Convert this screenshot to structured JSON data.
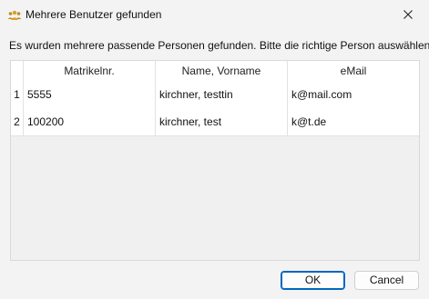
{
  "window": {
    "title": "Mehrere Benutzer gefunden",
    "icon": "users-group-icon",
    "close_icon": "close-icon"
  },
  "instruction": "Es wurden mehrere passende Personen gefunden. Bitte die richtige Person auswählen.",
  "table": {
    "columns": [
      "",
      "Matrikelnr.",
      "Name, Vorname",
      "eMail"
    ],
    "rows": [
      {
        "num": "1",
        "matrikel": "5555",
        "name": "kirchner, testtin",
        "email": "k@mail.com"
      },
      {
        "num": "2",
        "matrikel": "100200",
        "name": "kirchner, test",
        "email": "k@t.de"
      }
    ]
  },
  "buttons": {
    "ok": "OK",
    "cancel": "Cancel"
  },
  "colors": {
    "accent": "#0067c0",
    "icon": "#c08a1e"
  }
}
